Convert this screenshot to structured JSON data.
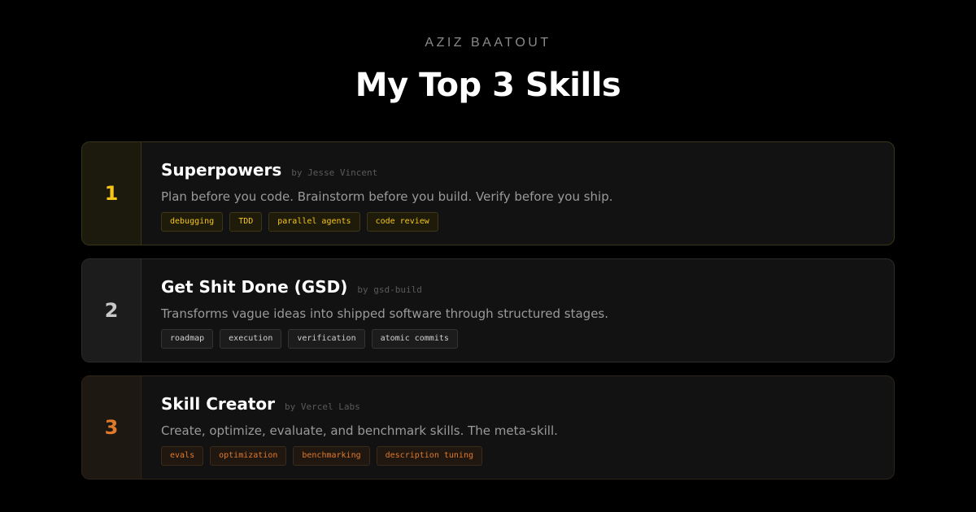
{
  "header": {
    "eyebrow": "AZIZ BAATOUT",
    "title": "My Top 3 Skills"
  },
  "colors": {
    "background": "#000000",
    "rank1_accent": "#f5c518",
    "rank2_accent": "#c8c8c8",
    "rank3_accent": "#e07a2a"
  },
  "skills": [
    {
      "rank": "1",
      "name": "Superpowers",
      "author": "by Jesse Vincent",
      "description": "Plan before you code. Brainstorm before you build. Verify before you ship.",
      "tags": [
        "debugging",
        "TDD",
        "parallel agents",
        "code review"
      ]
    },
    {
      "rank": "2",
      "name": "Get Shit Done (GSD)",
      "author": "by gsd-build",
      "description": "Transforms vague ideas into shipped software through structured stages.",
      "tags": [
        "roadmap",
        "execution",
        "verification",
        "atomic commits"
      ]
    },
    {
      "rank": "3",
      "name": "Skill Creator",
      "author": "by Vercel Labs",
      "description": "Create, optimize, evaluate, and benchmark skills. The meta-skill.",
      "tags": [
        "evals",
        "optimization",
        "benchmarking",
        "description tuning"
      ]
    }
  ]
}
